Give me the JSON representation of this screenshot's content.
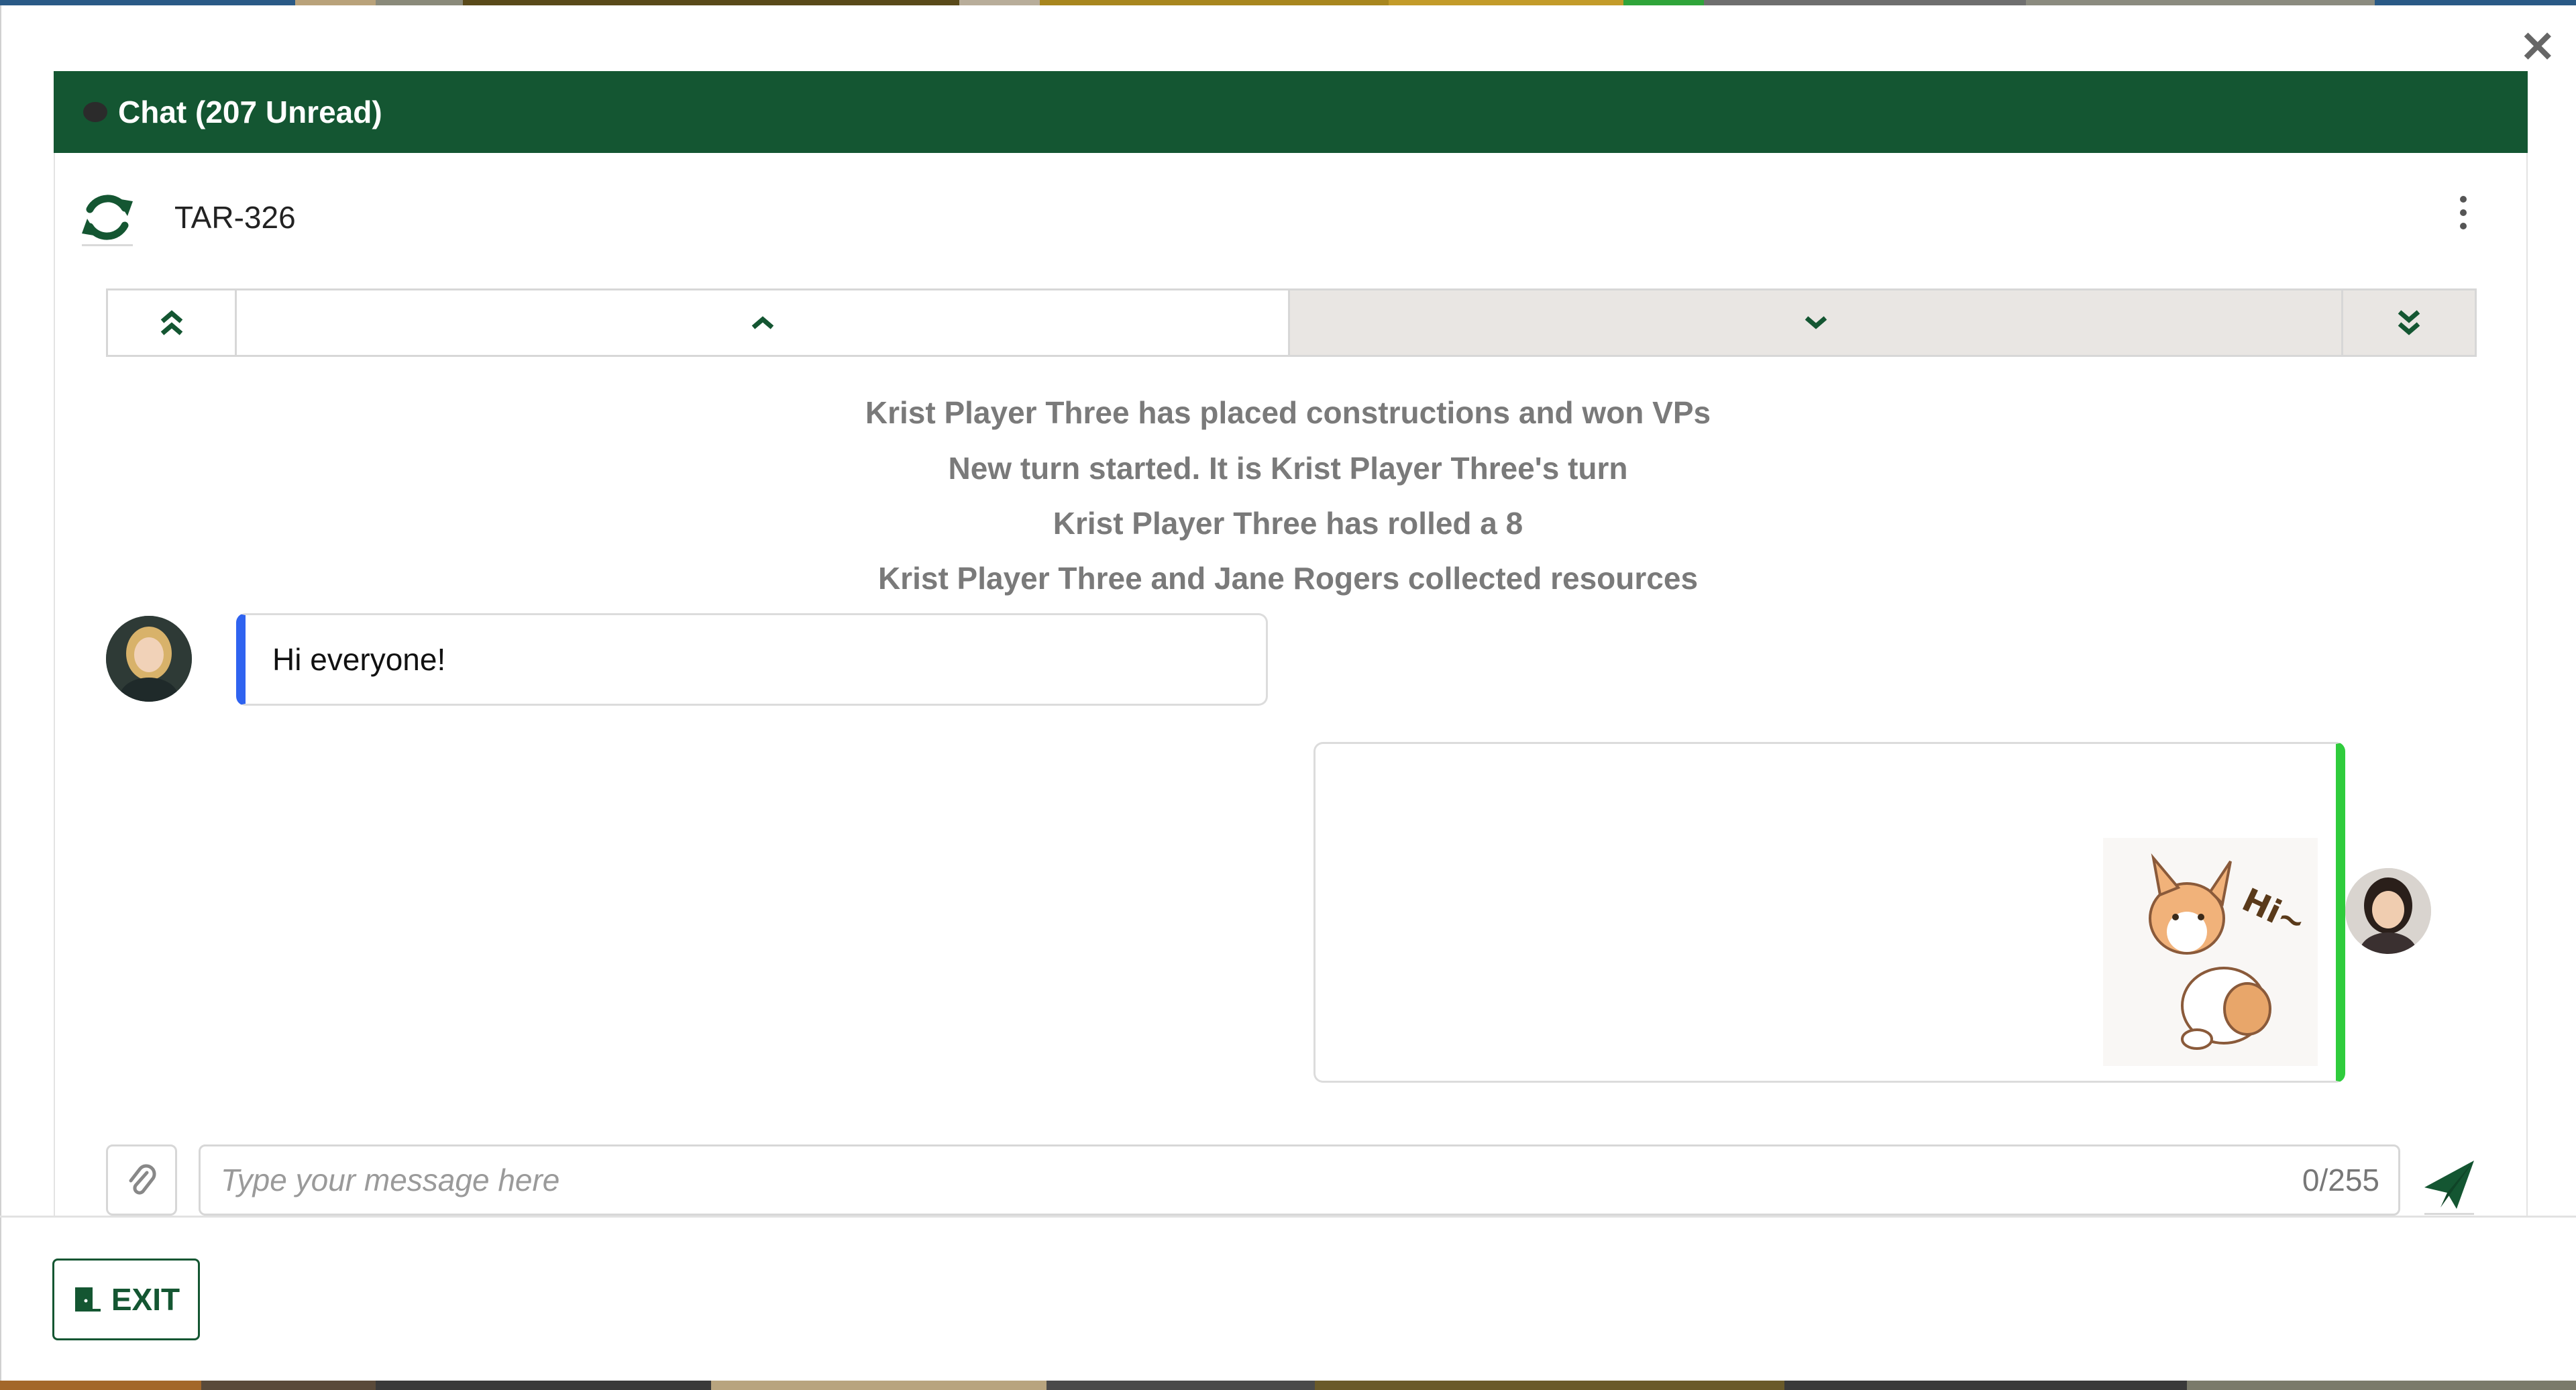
{
  "chat": {
    "header_title": "Chat (207 Unread)",
    "room_name": "TAR-326"
  },
  "messages": {
    "system": [
      "Krist Player Three has placed constructions and won VPs",
      "New turn started. It is Krist Player Three's turn",
      "Krist Player Three has rolled a 8",
      "Krist Player Three and Jane Rogers collected resources"
    ],
    "left_message": "Hi everyone!",
    "sticker_text": "Hi~"
  },
  "composer": {
    "placeholder": "Type your message here",
    "counter": "0/255"
  },
  "footer": {
    "exit_label": "EXIT"
  },
  "colors": {
    "header_bg": "#145632",
    "left_message_accent": "#2f63f0",
    "right_message_accent": "#2fcc3c",
    "brand_green": "#145632"
  },
  "icons": {
    "close": "close-icon",
    "chat_bubble": "chat-bubble-icon",
    "refresh": "refresh-icon",
    "more": "more-vertical-icon",
    "first": "double-chevron-up-icon",
    "prev": "chevron-up-icon",
    "next": "chevron-down-icon",
    "last": "double-chevron-down-icon",
    "attach": "paperclip-icon",
    "send": "send-icon",
    "exit": "door-exit-icon"
  }
}
